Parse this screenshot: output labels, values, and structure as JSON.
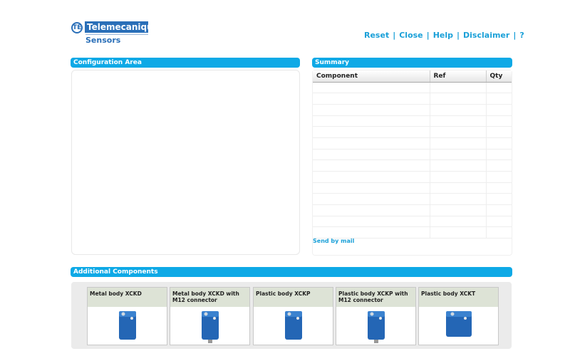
{
  "logo": {
    "brand": "Telemecanique",
    "sub": "Sensors"
  },
  "nav": [
    {
      "label": "Reset"
    },
    {
      "label": "Close"
    },
    {
      "label": "Help"
    },
    {
      "label": "Disclaimer"
    },
    {
      "label": "?"
    }
  ],
  "config": {
    "title": "Configuration Area"
  },
  "summary": {
    "title": "Summary",
    "columns": [
      "Component",
      "Ref",
      "Qty"
    ],
    "row_count": 14,
    "send_label": "Send by mail"
  },
  "additional": {
    "title": "Additional Components",
    "items": [
      {
        "label": "Metal body XCKD"
      },
      {
        "label": "Metal body XCKD with M12 connector"
      },
      {
        "label": "Plastic body XCKP"
      },
      {
        "label": "Plastic body XCKP with M12 connector"
      },
      {
        "label": "Plastic body XCKT"
      }
    ]
  },
  "colors": {
    "accent": "#0ea9e6",
    "brand": "#2a6fb8"
  }
}
